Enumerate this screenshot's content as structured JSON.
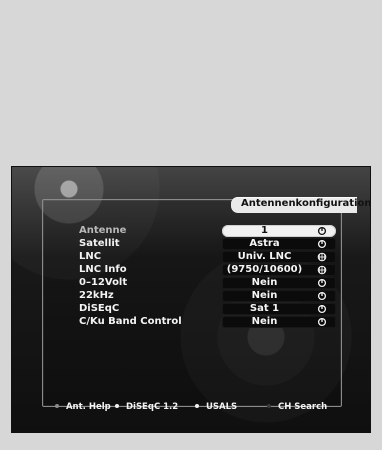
{
  "menu": {
    "title": "Antennenkonfiguration",
    "rows": [
      {
        "label": "Antenne",
        "value": "1",
        "selected": true,
        "dim": true,
        "icon": "power-symbol-icon"
      },
      {
        "label": "Satellit",
        "value": "Astra",
        "selected": false,
        "dim": false,
        "icon": "power-symbol-icon"
      },
      {
        "label": "LNC",
        "value": "Univ. LNC",
        "selected": false,
        "dim": false,
        "icon": "globe-icon"
      },
      {
        "label": "LNC Info",
        "value": "(9750/10600)",
        "selected": false,
        "dim": false,
        "icon": "globe-icon"
      },
      {
        "label": "0–12Volt",
        "value": "Nein",
        "selected": false,
        "dim": false,
        "icon": "power-symbol-icon"
      },
      {
        "label": "22kHz",
        "value": "Nein",
        "selected": false,
        "dim": false,
        "icon": "power-symbol-icon"
      },
      {
        "label": "DiSEqC",
        "value": "Sat 1",
        "selected": false,
        "dim": false,
        "icon": "power-symbol-icon"
      },
      {
        "label": "C/Ku Band Control",
        "value": "Nein",
        "selected": false,
        "dim": false,
        "icon": "power-symbol-icon"
      }
    ]
  },
  "help_bar": {
    "items": [
      {
        "label": "Ant. Help",
        "color": "#8b8b8b"
      },
      {
        "label": "DiSEqC 1.2",
        "color": "#f2f2f2"
      },
      {
        "label": "USALS",
        "color": "#f2f2f2"
      },
      {
        "label": "CH Search",
        "color": "#3a3a3a"
      }
    ]
  }
}
